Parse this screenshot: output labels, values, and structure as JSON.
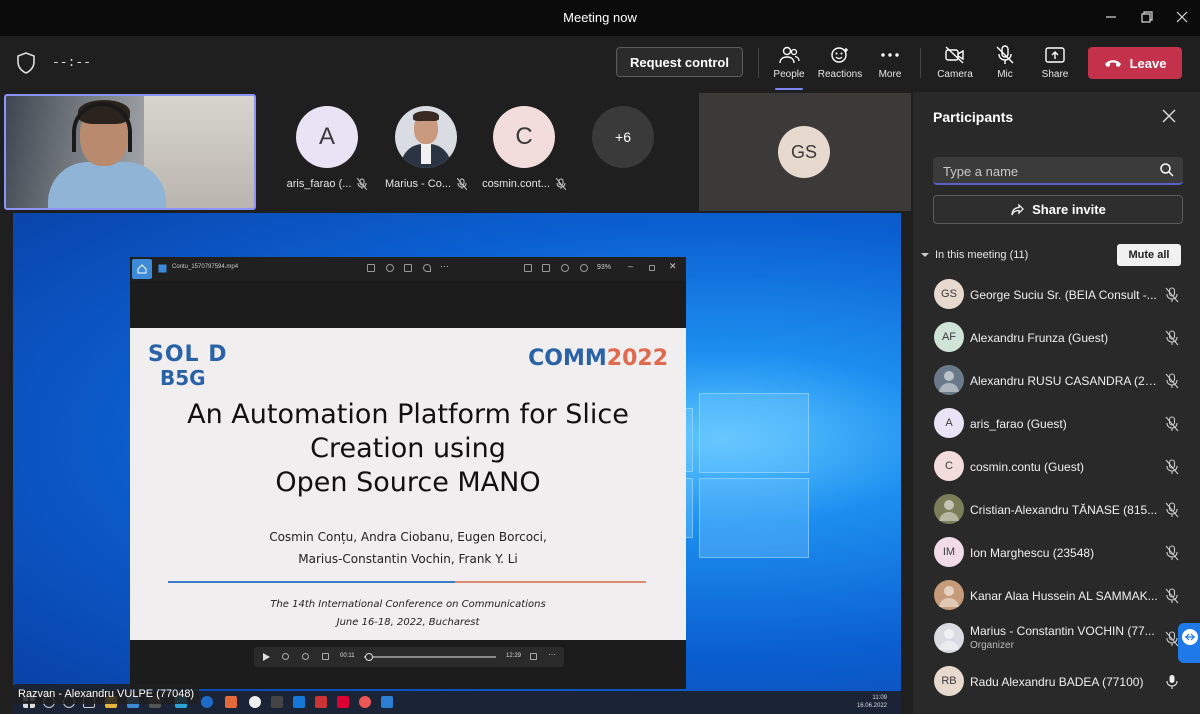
{
  "window": {
    "title": "Meeting now"
  },
  "toolbar": {
    "timer": "--:--",
    "request_control": "Request control",
    "people": "People",
    "reactions": "Reactions",
    "more": "More",
    "camera": "Camera",
    "mic": "Mic",
    "share": "Share",
    "leave": "Leave"
  },
  "stage": {
    "tiles": [
      {
        "initials": "A",
        "name": "aris_farao (...",
        "color": "#e9e4f5"
      },
      {
        "initials": "",
        "name": "Marius - Co...",
        "color": "#d9dde3"
      },
      {
        "initials": "C",
        "name": "cosmin.cont...",
        "color": "#f3dcdc"
      }
    ],
    "overflow": "+6",
    "gs_initials": "GS",
    "presenter_label": "Razvan - Alexandru VULPE (77048)"
  },
  "shared_screen": {
    "file_name": "Contu_1570797594.mp4",
    "zoom": "93%",
    "logo_left_1": "SOL D",
    "logo_left_2": "B5G",
    "logo_right_1": "C",
    "logo_right_2": "MM",
    "logo_right_year": "2022",
    "title_lines": [
      "An Automation Platform for Slice",
      "Creation using",
      "Open Source MANO"
    ],
    "authors": [
      "Cosmin Conțu, Andra Ciobanu, Eugen Borcoci,",
      "Marius-Constantin Vochin, Frank Y. Li"
    ],
    "conference": [
      "The 14th International Conference on Communications",
      "June 16-18, 2022, Bucharest"
    ],
    "elapsed": "00:11",
    "duration": "12:29",
    "progress": 0.015,
    "taskbar_time": "11:09",
    "taskbar_date": "16.06.2022"
  },
  "participants": {
    "title": "Participants",
    "search_placeholder": "Type a name",
    "share_invite": "Share invite",
    "in_meeting": "In this meeting (11)",
    "mute_all": "Mute all",
    "list": [
      {
        "initials": "GS",
        "name": "George Suciu Sr. (BEIA Consult -...",
        "color": "#e8d9cf",
        "role": "",
        "mic": "muted"
      },
      {
        "initials": "AF",
        "name": "Alexandru Frunza (Guest)",
        "color": "#cfe3d6",
        "role": "",
        "mic": "muted"
      },
      {
        "initials": "",
        "name": "Alexandru RUSU CASANDRA (23...",
        "color": "#6b7a8a",
        "role": "",
        "mic": "muted"
      },
      {
        "initials": "A",
        "name": "aris_farao (Guest)",
        "color": "#e9e4f5",
        "role": "",
        "mic": "muted"
      },
      {
        "initials": "C",
        "name": "cosmin.contu (Guest)",
        "color": "#f3dcdc",
        "role": "",
        "mic": "muted"
      },
      {
        "initials": "",
        "name": "Cristian-Alexandru TĂNASE (815...",
        "color": "#7a7f5a",
        "role": "",
        "mic": "muted"
      },
      {
        "initials": "IM",
        "name": "Ion Marghescu (23548)",
        "color": "#f2dbe8",
        "role": "",
        "mic": "muted"
      },
      {
        "initials": "",
        "name": "Kanar Alaa Hussein AL SAMMAK...",
        "color": "#c69b7a",
        "role": "",
        "mic": "muted"
      },
      {
        "initials": "",
        "name": "Marius - Constantin VOCHIN (77...",
        "color": "#d9dde3",
        "role": "Organizer",
        "mic": "muted"
      },
      {
        "initials": "RB",
        "name": "Radu Alexandru BADEA (77100)",
        "color": "#e8d9cf",
        "role": "",
        "mic": "on"
      }
    ]
  }
}
